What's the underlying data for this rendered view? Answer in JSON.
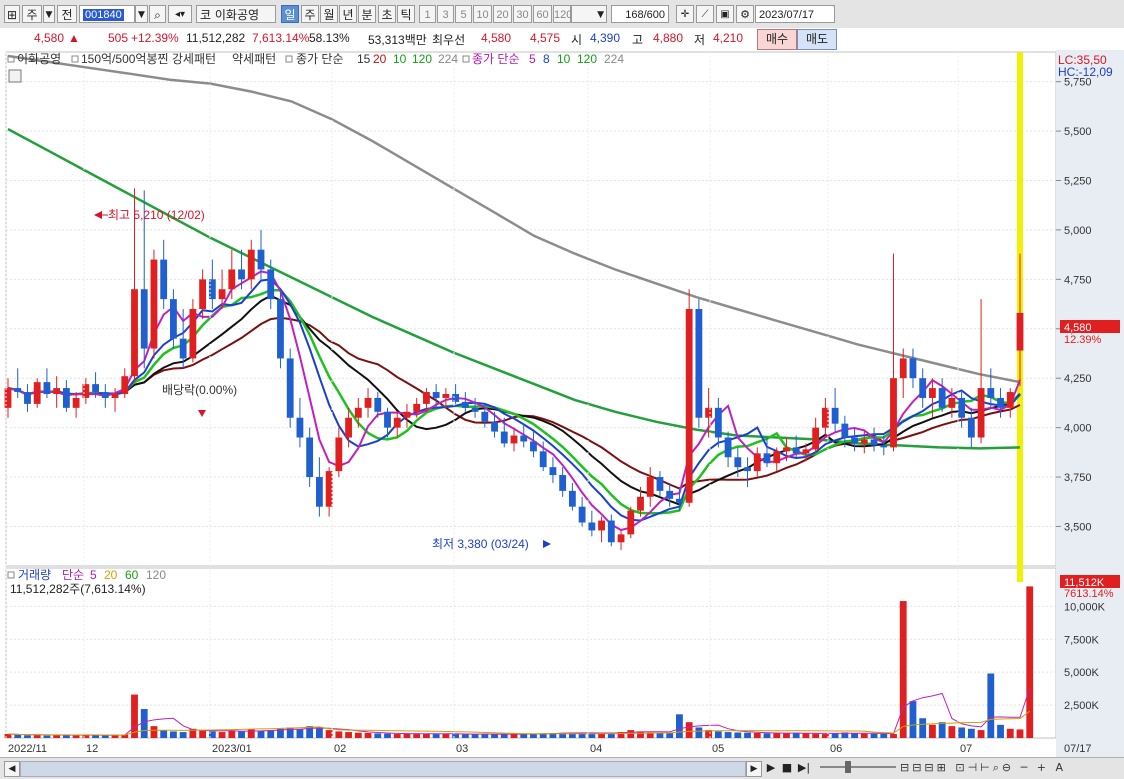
{
  "toolbar": {
    "mode": "주",
    "prev": "전",
    "code": "001840",
    "name_prefix": "코",
    "stock_name": "이화공영",
    "periods": [
      "일",
      "주",
      "월",
      "년",
      "분",
      "초",
      "틱"
    ],
    "intervals": [
      "1",
      "3",
      "5",
      "10",
      "20",
      "30",
      "60",
      "120"
    ],
    "count": "168",
    "max": "/600",
    "date": "2023/07/17"
  },
  "info": {
    "price": "4,580",
    "arrow": "▲",
    "change": "505",
    "change_pct": "+12.39%",
    "volume": "11,512,282",
    "vol_pct": "7,613.14%",
    "turnover": "58.13%",
    "amount": "53,313백만",
    "best_label": "최우선",
    "ask": "4,580",
    "bid": "4,575",
    "open_label": "시",
    "open": "4,390",
    "high_label": "고",
    "high": "4,880",
    "low_label": "저",
    "low": "4,210",
    "buy": "매수",
    "sell": "매도"
  },
  "legend": {
    "title": "이화공영",
    "pattern1": "150억/500억봉찐 강세패턴",
    "pattern2": "약세패턴",
    "ma_label": "종가 단순",
    "ma_periods1": [
      "15",
      "20",
      "10",
      "120",
      "224"
    ],
    "ma_label2": "종가 단순",
    "ma_periods2": [
      "5",
      "8",
      "10",
      "120",
      "224"
    ]
  },
  "annotations": {
    "high": "최고 5,210 (12/02)",
    "low": "최저 3,380 (03/24)",
    "dividend": "배당락(0.00%)",
    "lc": "LC:35,50",
    "hc": "HC:-12,09"
  },
  "price_axis": {
    "ticks": [
      "5,750",
      "5,500",
      "5,250",
      "5,000",
      "4,750",
      "4,500",
      "4,250",
      "4,000",
      "3,750",
      "3,500"
    ],
    "last_price": "4,580",
    "last_pct": "12.39%"
  },
  "volume_panel": {
    "legend_title": "거래량",
    "ma_label": "단순",
    "ma_periods": [
      "5",
      "20",
      "60",
      "120"
    ],
    "current": "11,512,282주(7,613.14%)",
    "ticks": [
      "10,000K",
      "7,500K",
      "5,000K",
      "2,500K"
    ],
    "last_value": "11,512K",
    "last_pct": "7613.14%"
  },
  "x_axis": {
    "labels": [
      "2022/11",
      "12",
      "2023/01",
      "02",
      "03",
      "04",
      "05",
      "06",
      "07"
    ],
    "right_label": "07/17"
  },
  "colors": {
    "up": "#e02020",
    "down": "#1f5fd0",
    "ma_long": "#8c8c8c",
    "ma_224": "#22a03a",
    "highlight": "#f0f000"
  },
  "chart_data": {
    "type": "candlestick",
    "y_range": [
      3300,
      5900
    ],
    "volume_range_k": [
      0,
      12000
    ],
    "candles": [
      {
        "o": 4100,
        "h": 4250,
        "l": 4050,
        "c": 4200
      },
      {
        "o": 4200,
        "h": 4300,
        "l": 4150,
        "c": 4180
      },
      {
        "o": 4180,
        "h": 4220,
        "l": 4080,
        "c": 4120
      },
      {
        "o": 4120,
        "h": 4250,
        "l": 4100,
        "c": 4230
      },
      {
        "o": 4230,
        "h": 4300,
        "l": 4150,
        "c": 4170
      },
      {
        "o": 4170,
        "h": 4260,
        "l": 4100,
        "c": 4200
      },
      {
        "o": 4200,
        "h": 4240,
        "l": 4080,
        "c": 4100
      },
      {
        "o": 4100,
        "h": 4180,
        "l": 4050,
        "c": 4150
      },
      {
        "o": 4150,
        "h": 4250,
        "l": 4120,
        "c": 4220
      },
      {
        "o": 4220,
        "h": 4280,
        "l": 4150,
        "c": 4180
      },
      {
        "o": 4180,
        "h": 4220,
        "l": 4100,
        "c": 4150
      },
      {
        "o": 4150,
        "h": 4200,
        "l": 4080,
        "c": 4170
      },
      {
        "o": 4170,
        "h": 4300,
        "l": 4150,
        "c": 4260
      },
      {
        "o": 4260,
        "h": 5210,
        "l": 4230,
        "c": 4700
      },
      {
        "o": 4700,
        "h": 5200,
        "l": 4300,
        "c": 4400
      },
      {
        "o": 4400,
        "h": 4900,
        "l": 4350,
        "c": 4850
      },
      {
        "o": 4850,
        "h": 4950,
        "l": 4600,
        "c": 4650
      },
      {
        "o": 4650,
        "h": 4700,
        "l": 4400,
        "c": 4450
      },
      {
        "o": 4450,
        "h": 4600,
        "l": 4300,
        "c": 4350
      },
      {
        "o": 4350,
        "h": 4650,
        "l": 4330,
        "c": 4600
      },
      {
        "o": 4600,
        "h": 4800,
        "l": 4550,
        "c": 4750
      },
      {
        "o": 4750,
        "h": 4850,
        "l": 4600,
        "c": 4650
      },
      {
        "o": 4650,
        "h": 4800,
        "l": 4600,
        "c": 4700
      },
      {
        "o": 4700,
        "h": 4900,
        "l": 4650,
        "c": 4800
      },
      {
        "o": 4800,
        "h": 4900,
        "l": 4700,
        "c": 4750
      },
      {
        "o": 4750,
        "h": 4950,
        "l": 4700,
        "c": 4900
      },
      {
        "o": 4900,
        "h": 5000,
        "l": 4750,
        "c": 4800
      },
      {
        "o": 4800,
        "h": 4850,
        "l": 4600,
        "c": 4650
      },
      {
        "o": 4650,
        "h": 4700,
        "l": 4300,
        "c": 4350
      },
      {
        "o": 4350,
        "h": 4400,
        "l": 4000,
        "c": 4050
      },
      {
        "o": 4050,
        "h": 4150,
        "l": 3900,
        "c": 3950
      },
      {
        "o": 3950,
        "h": 4000,
        "l": 3700,
        "c": 3750
      },
      {
        "o": 3750,
        "h": 3850,
        "l": 3550,
        "c": 3600
      },
      {
        "o": 3600,
        "h": 3800,
        "l": 3550,
        "c": 3780
      },
      {
        "o": 3780,
        "h": 4000,
        "l": 3750,
        "c": 3950
      },
      {
        "o": 3950,
        "h": 4100,
        "l": 3900,
        "c": 4050
      },
      {
        "o": 4050,
        "h": 4150,
        "l": 4000,
        "c": 4100
      },
      {
        "o": 4100,
        "h": 4200,
        "l": 4050,
        "c": 4150
      },
      {
        "o": 4150,
        "h": 4180,
        "l": 4050,
        "c": 4080
      },
      {
        "o": 4080,
        "h": 4100,
        "l": 3950,
        "c": 4000
      },
      {
        "o": 4000,
        "h": 4080,
        "l": 3950,
        "c": 4050
      },
      {
        "o": 4050,
        "h": 4120,
        "l": 4000,
        "c": 4080
      },
      {
        "o": 4080,
        "h": 4150,
        "l": 4050,
        "c": 4120
      },
      {
        "o": 4120,
        "h": 4200,
        "l": 4080,
        "c": 4180
      },
      {
        "o": 4180,
        "h": 4220,
        "l": 4100,
        "c": 4150
      },
      {
        "o": 4150,
        "h": 4200,
        "l": 4100,
        "c": 4170
      },
      {
        "o": 4170,
        "h": 4220,
        "l": 4120,
        "c": 4130
      },
      {
        "o": 4130,
        "h": 4180,
        "l": 4080,
        "c": 4100
      },
      {
        "o": 4100,
        "h": 4150,
        "l": 4050,
        "c": 4080
      },
      {
        "o": 4080,
        "h": 4120,
        "l": 4000,
        "c": 4030
      },
      {
        "o": 4030,
        "h": 4080,
        "l": 3950,
        "c": 3980
      },
      {
        "o": 3980,
        "h": 4050,
        "l": 3900,
        "c": 3920
      },
      {
        "o": 3920,
        "h": 4000,
        "l": 3880,
        "c": 3960
      },
      {
        "o": 3960,
        "h": 4020,
        "l": 3900,
        "c": 3930
      },
      {
        "o": 3930,
        "h": 3980,
        "l": 3850,
        "c": 3880
      },
      {
        "o": 3880,
        "h": 3930,
        "l": 3780,
        "c": 3800
      },
      {
        "o": 3800,
        "h": 3850,
        "l": 3720,
        "c": 3760
      },
      {
        "o": 3760,
        "h": 3800,
        "l": 3650,
        "c": 3680
      },
      {
        "o": 3680,
        "h": 3720,
        "l": 3580,
        "c": 3600
      },
      {
        "o": 3600,
        "h": 3650,
        "l": 3500,
        "c": 3520
      },
      {
        "o": 3520,
        "h": 3580,
        "l": 3450,
        "c": 3480
      },
      {
        "o": 3480,
        "h": 3550,
        "l": 3420,
        "c": 3530
      },
      {
        "o": 3530,
        "h": 3560,
        "l": 3400,
        "c": 3420
      },
      {
        "o": 3420,
        "h": 3480,
        "l": 3380,
        "c": 3460
      },
      {
        "o": 3460,
        "h": 3600,
        "l": 3440,
        "c": 3580
      },
      {
        "o": 3580,
        "h": 3700,
        "l": 3550,
        "c": 3650
      },
      {
        "o": 3650,
        "h": 3800,
        "l": 3600,
        "c": 3750
      },
      {
        "o": 3750,
        "h": 3780,
        "l": 3650,
        "c": 3680
      },
      {
        "o": 3680,
        "h": 3720,
        "l": 3600,
        "c": 3640
      },
      {
        "o": 3640,
        "h": 3700,
        "l": 3580,
        "c": 3620
      },
      {
        "o": 3620,
        "h": 4700,
        "l": 3600,
        "c": 4600
      },
      {
        "o": 4600,
        "h": 4650,
        "l": 4000,
        "c": 4050
      },
      {
        "o": 4050,
        "h": 4200,
        "l": 3950,
        "c": 4100
      },
      {
        "o": 4100,
        "h": 4150,
        "l": 3900,
        "c": 3950
      },
      {
        "o": 3950,
        "h": 3980,
        "l": 3800,
        "c": 3850
      },
      {
        "o": 3850,
        "h": 3900,
        "l": 3750,
        "c": 3800
      },
      {
        "o": 3800,
        "h": 3850,
        "l": 3700,
        "c": 3780
      },
      {
        "o": 3780,
        "h": 3900,
        "l": 3750,
        "c": 3870
      },
      {
        "o": 3870,
        "h": 3950,
        "l": 3800,
        "c": 3820
      },
      {
        "o": 3820,
        "h": 3900,
        "l": 3780,
        "c": 3880
      },
      {
        "o": 3880,
        "h": 3950,
        "l": 3830,
        "c": 3900
      },
      {
        "o": 3900,
        "h": 3960,
        "l": 3850,
        "c": 3870
      },
      {
        "o": 3870,
        "h": 3920,
        "l": 3830,
        "c": 3890
      },
      {
        "o": 3890,
        "h": 4050,
        "l": 3870,
        "c": 4000
      },
      {
        "o": 4000,
        "h": 4150,
        "l": 3950,
        "c": 4100
      },
      {
        "o": 4100,
        "h": 4200,
        "l": 3980,
        "c": 4020
      },
      {
        "o": 4020,
        "h": 4060,
        "l": 3900,
        "c": 3950
      },
      {
        "o": 3950,
        "h": 4000,
        "l": 3880,
        "c": 3920
      },
      {
        "o": 3920,
        "h": 3980,
        "l": 3870,
        "c": 3940
      },
      {
        "o": 3940,
        "h": 4000,
        "l": 3880,
        "c": 3910
      },
      {
        "o": 3910,
        "h": 3960,
        "l": 3860,
        "c": 3900
      },
      {
        "o": 3900,
        "h": 4880,
        "l": 3880,
        "c": 4250
      },
      {
        "o": 4250,
        "h": 4400,
        "l": 4150,
        "c": 4350
      },
      {
        "o": 4350,
        "h": 4400,
        "l": 4200,
        "c": 4250
      },
      {
        "o": 4250,
        "h": 4300,
        "l": 4100,
        "c": 4150
      },
      {
        "o": 4150,
        "h": 4250,
        "l": 4050,
        "c": 4200
      },
      {
        "o": 4200,
        "h": 4250,
        "l": 4080,
        "c": 4100
      },
      {
        "o": 4100,
        "h": 4200,
        "l": 4050,
        "c": 4150
      },
      {
        "o": 4150,
        "h": 4180,
        "l": 4000,
        "c": 4050
      },
      {
        "o": 4050,
        "h": 4100,
        "l": 3900,
        "c": 3950
      },
      {
        "o": 3950,
        "h": 4650,
        "l": 3920,
        "c": 4200
      },
      {
        "o": 4200,
        "h": 4300,
        "l": 4100,
        "c": 4150
      },
      {
        "o": 4150,
        "h": 4200,
        "l": 4050,
        "c": 4100
      },
      {
        "o": 4100,
        "h": 4200,
        "l": 4050,
        "c": 4180
      },
      {
        "o": 4390,
        "h": 4880,
        "l": 4210,
        "c": 4580
      }
    ],
    "volume_k": [
      300,
      250,
      200,
      260,
      180,
      240,
      220,
      200,
      260,
      210,
      190,
      220,
      260,
      3300,
      2200,
      900,
      600,
      500,
      450,
      700,
      600,
      500,
      450,
      550,
      500,
      650,
      550,
      600,
      700,
      800,
      650,
      900,
      750,
      600,
      500,
      450,
      400,
      380,
      350,
      330,
      300,
      320,
      350,
      330,
      300,
      310,
      290,
      280,
      300,
      320,
      280,
      300,
      290,
      310,
      330,
      350,
      380,
      400,
      420,
      380,
      360,
      350,
      400,
      450,
      600,
      500,
      420,
      400,
      380,
      1800,
      1200,
      800,
      600,
      500,
      450,
      420,
      400,
      380,
      360,
      350,
      380,
      400,
      350,
      330,
      300,
      380,
      420,
      360,
      330,
      320,
      310,
      300,
      10400,
      2800,
      1500,
      1000,
      1200,
      900,
      800,
      700,
      600,
      4900,
      1000,
      700,
      650,
      11512
    ],
    "ma_224": [
      5510,
      5400,
      5290,
      5180,
      5070,
      4960,
      4860,
      4760,
      4660,
      4560,
      4470,
      4380,
      4300,
      4220,
      4140,
      4080,
      4030,
      3990,
      3960,
      3950,
      3940,
      3920,
      3910,
      3900,
      3895,
      3900
    ],
    "ma_long": [
      5880,
      5850,
      5820,
      5790,
      5760,
      5740,
      5700,
      5650,
      5560,
      5450,
      5330,
      5210,
      5090,
      4970,
      4880,
      4800,
      4730,
      4660,
      4600,
      4540,
      4480,
      4420,
      4370,
      4320,
      4270,
      4230
    ]
  }
}
